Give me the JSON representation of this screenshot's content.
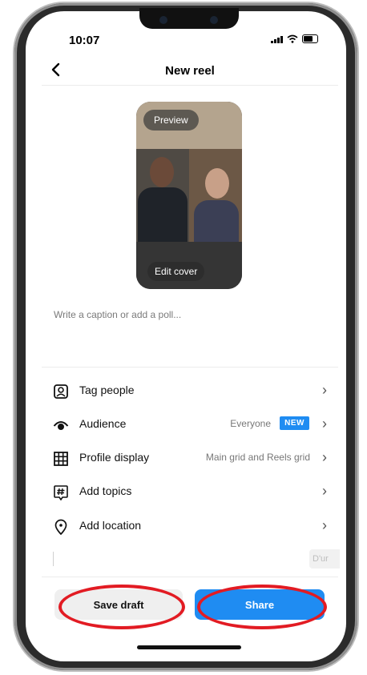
{
  "status_bar": {
    "time": "10:07"
  },
  "header": {
    "title": "New reel",
    "back_icon": "chevron-left-icon"
  },
  "preview": {
    "preview_label": "Preview",
    "edit_cover_label": "Edit cover"
  },
  "caption": {
    "placeholder": "Write a caption or add a poll..."
  },
  "menu": {
    "items": [
      {
        "label": "Tag people",
        "value": "",
        "icon": "tag-person-icon"
      },
      {
        "label": "Audience",
        "value": "Everyone",
        "badge": "NEW",
        "icon": "eye-icon"
      },
      {
        "label": "Profile display",
        "value": "Main grid and Reels grid",
        "icon": "grid-icon"
      },
      {
        "label": "Add topics",
        "value": "",
        "icon": "hashtag-icon"
      },
      {
        "label": "Add location",
        "value": "",
        "icon": "location-pin-icon"
      }
    ]
  },
  "partial_chip": {
    "text": "D'ur"
  },
  "actions": {
    "save_draft": "Save draft",
    "share": "Share"
  },
  "colors": {
    "accent": "#1f8cf2",
    "highlight_ring": "#e21b23"
  }
}
